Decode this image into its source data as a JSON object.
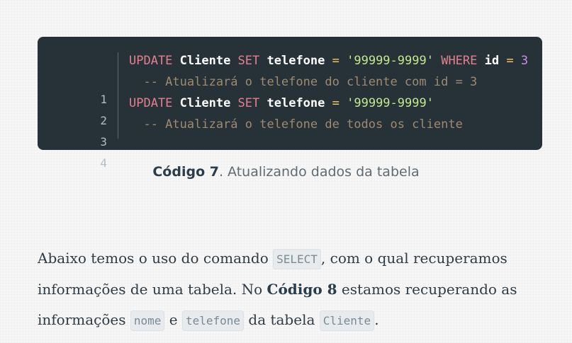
{
  "code": {
    "line_numbers": [
      "1",
      "2",
      "3",
      "4"
    ],
    "lines": [
      {
        "kw1": "UPDATE",
        "t1": " Cliente ",
        "kw2": "SET",
        "t2": " telefone ",
        "op1": "=",
        "sp1": " ",
        "str1": "'99999-9999'",
        "sp2": " ",
        "kw3": "WHERE",
        "t3": " id ",
        "op2": "=",
        "sp3": " ",
        "num1": "3"
      },
      {
        "comment": "  -- Atualizará o telefone do cliente com id = 3"
      },
      {
        "kw1": "UPDATE",
        "t1": " Cliente ",
        "kw2": "SET",
        "t2": " telefone ",
        "op1": "=",
        "sp1": " ",
        "str1": "'99999-9999'"
      },
      {
        "comment": "  -- Atualizará o telefone de todos os cliente"
      }
    ]
  },
  "caption": {
    "label": "Código 7",
    "text": ". Atualizando dados da tabela"
  },
  "paragraph": {
    "p1": "Abaixo temos o uso do comando ",
    "code_select": "SELECT",
    "p2": ", com o qual recuperamos informações de uma tabela. No ",
    "bold_ref": "Código 8",
    "p3": " estamos recuperando as informações ",
    "code_nome": "nome",
    "p4": " e ",
    "code_telefone": "telefone",
    "p5": " da tabela ",
    "code_cliente": "Cliente",
    "p6": "."
  },
  "colors": {
    "code_bg": "#263238",
    "keyword": "#e57f8f",
    "operator": "#ffcb6b",
    "string": "#c3e88d",
    "number": "#c792ea",
    "comment": "#9e8a6e"
  }
}
